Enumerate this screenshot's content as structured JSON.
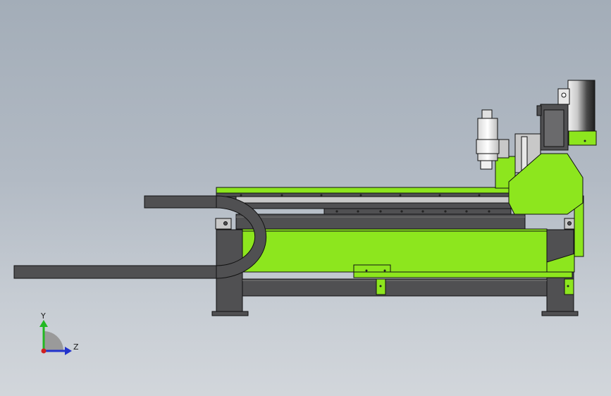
{
  "colors": {
    "machine_green": "#8de61e",
    "dark_gray": "#505052",
    "light_gray": "#c8c8c8",
    "outline": "#111111",
    "axis_y": "#22b822",
    "axis_z": "#2233cc",
    "axis_origin": "#d02020"
  },
  "triad": {
    "y_label": "Y",
    "z_label": "Z"
  }
}
